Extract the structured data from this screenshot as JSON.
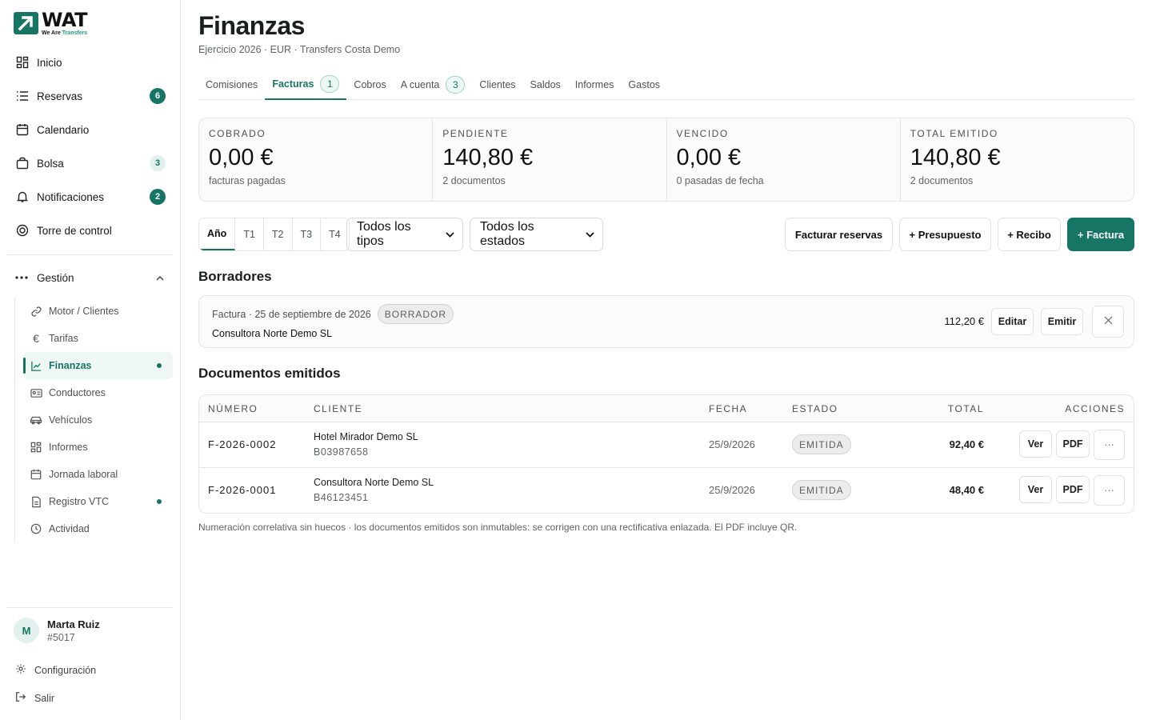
{
  "brand": {
    "word": "WAT",
    "tagline_prefix": "We Are",
    "tagline_accent": "Transfers"
  },
  "nav": {
    "items": [
      {
        "label": "Inicio",
        "icon": "grid-icon"
      },
      {
        "label": "Reservas",
        "icon": "list-icon",
        "badge": "6"
      },
      {
        "label": "Calendario",
        "icon": "calendar-icon"
      },
      {
        "label": "Bolsa",
        "icon": "bag-icon",
        "badge": "3"
      },
      {
        "label": "Notificaciones",
        "icon": "bell-icon",
        "badge": "2"
      },
      {
        "label": "Torre de control",
        "icon": "target-icon"
      }
    ],
    "group": {
      "label": "Gestión",
      "icon": "more-icon"
    },
    "sub": [
      {
        "label": "Motor / Clientes",
        "icon": "link-icon"
      },
      {
        "label": "Tarifas",
        "icon": "euro-icon"
      },
      {
        "label": "Finanzas",
        "icon": "chart-icon"
      },
      {
        "label": "Conductores",
        "icon": "id-card-icon"
      },
      {
        "label": "Vehículos",
        "icon": "car-icon"
      },
      {
        "label": "Informes",
        "icon": "grid-icon"
      },
      {
        "label": "Jornada laboral",
        "icon": "calendar-icon"
      },
      {
        "label": "Registro VTC",
        "icon": "file-icon"
      },
      {
        "label": "Actividad",
        "icon": "clock-icon"
      }
    ]
  },
  "user": {
    "initial": "M",
    "name": "Marta Ruiz",
    "id": "#5017"
  },
  "footer": {
    "settings": "Configuración",
    "logout": "Salir"
  },
  "page": {
    "title": "Finanzas",
    "subtitle": "Ejercicio 2026 · EUR · Transfers Costa Demo"
  },
  "tabs": [
    {
      "label": "Comisiones"
    },
    {
      "label": "Facturas",
      "count": "1"
    },
    {
      "label": "Cobros"
    },
    {
      "label": "A cuenta",
      "count": "3"
    },
    {
      "label": "Clientes"
    },
    {
      "label": "Saldos"
    },
    {
      "label": "Informes"
    },
    {
      "label": "Gastos"
    }
  ],
  "kpis": [
    {
      "label": "COBRADO",
      "value": "0,00 €",
      "note": "facturas pagadas"
    },
    {
      "label": "PENDIENTE",
      "value": "140,80 €",
      "note": "2 documentos"
    },
    {
      "label": "VENCIDO",
      "value": "0,00 €",
      "note": "0 pasadas de fecha"
    },
    {
      "label": "TOTAL EMITIDO",
      "value": "140,80 €",
      "note": "2 documentos"
    }
  ],
  "filters": {
    "periods": [
      "Año",
      "T1",
      "T2",
      "T3",
      "T4"
    ],
    "type_select": "Todos los tipos",
    "status_select": "Todos los estados"
  },
  "actions": {
    "bill_bookings": "Facturar reservas",
    "quote": "+ Presupuesto",
    "receipt": "+ Recibo",
    "invoice": "+ Factura"
  },
  "drafts": {
    "title": "Borradores",
    "item": {
      "meta": "Factura · 25 de septiembre de 2026",
      "status": "BORRADOR",
      "client": "Consultora Norte Demo SL",
      "amount": "112,20 €",
      "edit": "Editar",
      "issue": "Emitir"
    }
  },
  "documents": {
    "title": "Documentos emitidos",
    "headers": {
      "number": "NÚMERO",
      "client": "CLIENTE",
      "date": "FECHA",
      "status": "ESTADO",
      "total": "TOTAL",
      "actions": "ACCIONES"
    },
    "rows": [
      {
        "number": "F-2026-0002",
        "client": "Hotel Mirador Demo SL",
        "tax_id": "B03987658",
        "date": "25/9/2026",
        "status": "EMITIDA",
        "total": "92,40 €",
        "view": "Ver",
        "pdf": "PDF",
        "more": "···"
      },
      {
        "number": "F-2026-0001",
        "client": "Consultora Norte Demo SL",
        "tax_id": "B46123451",
        "date": "25/9/2026",
        "status": "EMITIDA",
        "total": "48,40 €",
        "view": "Ver",
        "pdf": "PDF",
        "more": "···"
      }
    ],
    "footnote": "Numeración correlativa sin huecos · los documentos emitidos son inmutables: se corrigen con una rectificativa enlazada. El PDF incluye QR."
  },
  "colors": {
    "accent": "#167565",
    "accent_light": "#e2f1ed"
  }
}
